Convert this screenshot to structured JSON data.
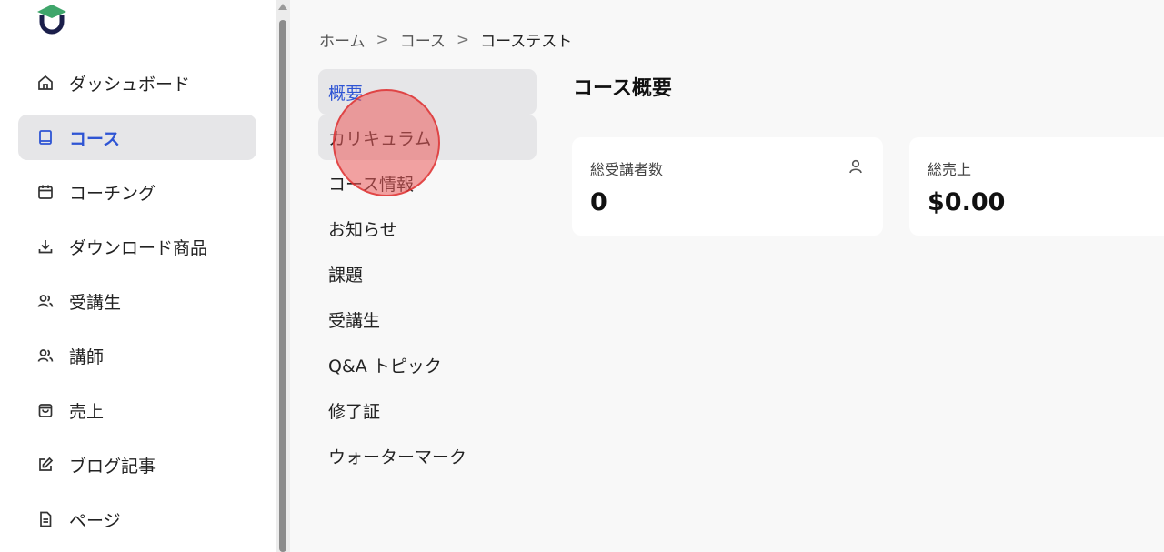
{
  "sidebar": {
    "items": [
      {
        "label": "ダッシュボード",
        "icon": "home-icon"
      },
      {
        "label": "コース",
        "icon": "book-icon",
        "active": true
      },
      {
        "label": "コーチング",
        "icon": "calendar-icon"
      },
      {
        "label": "ダウンロード商品",
        "icon": "download-icon"
      },
      {
        "label": "受講生",
        "icon": "users-icon"
      },
      {
        "label": "講師",
        "icon": "users-icon"
      },
      {
        "label": "売上",
        "icon": "shopping-bag-icon"
      },
      {
        "label": "ブログ記事",
        "icon": "edit-icon"
      },
      {
        "label": "ページ",
        "icon": "document-icon"
      }
    ]
  },
  "breadcrumb": {
    "home": "ホーム",
    "courses": "コース",
    "current": "コーステスト",
    "separator": ">"
  },
  "subnav": {
    "items": [
      {
        "label": "概要",
        "active": true
      },
      {
        "label": "カリキュラム",
        "hover": true
      },
      {
        "label": "コース情報"
      },
      {
        "label": "お知らせ"
      },
      {
        "label": "課題"
      },
      {
        "label": "受講生"
      },
      {
        "label": "Q&A トピック"
      },
      {
        "label": "修了証"
      },
      {
        "label": "ウォーターマーク"
      }
    ]
  },
  "main": {
    "title": "コース概要",
    "stats": [
      {
        "label": "総受講者数",
        "value": "0",
        "icon": "user-icon"
      },
      {
        "label": "総売上",
        "value": "$0.00"
      }
    ]
  },
  "colors": {
    "accent": "#2f55d4",
    "active_bg": "#e6e6e8",
    "logo_green": "#3fa66b",
    "logo_navy": "#1b1f4b",
    "click_indicator": "#eb5a5a"
  }
}
